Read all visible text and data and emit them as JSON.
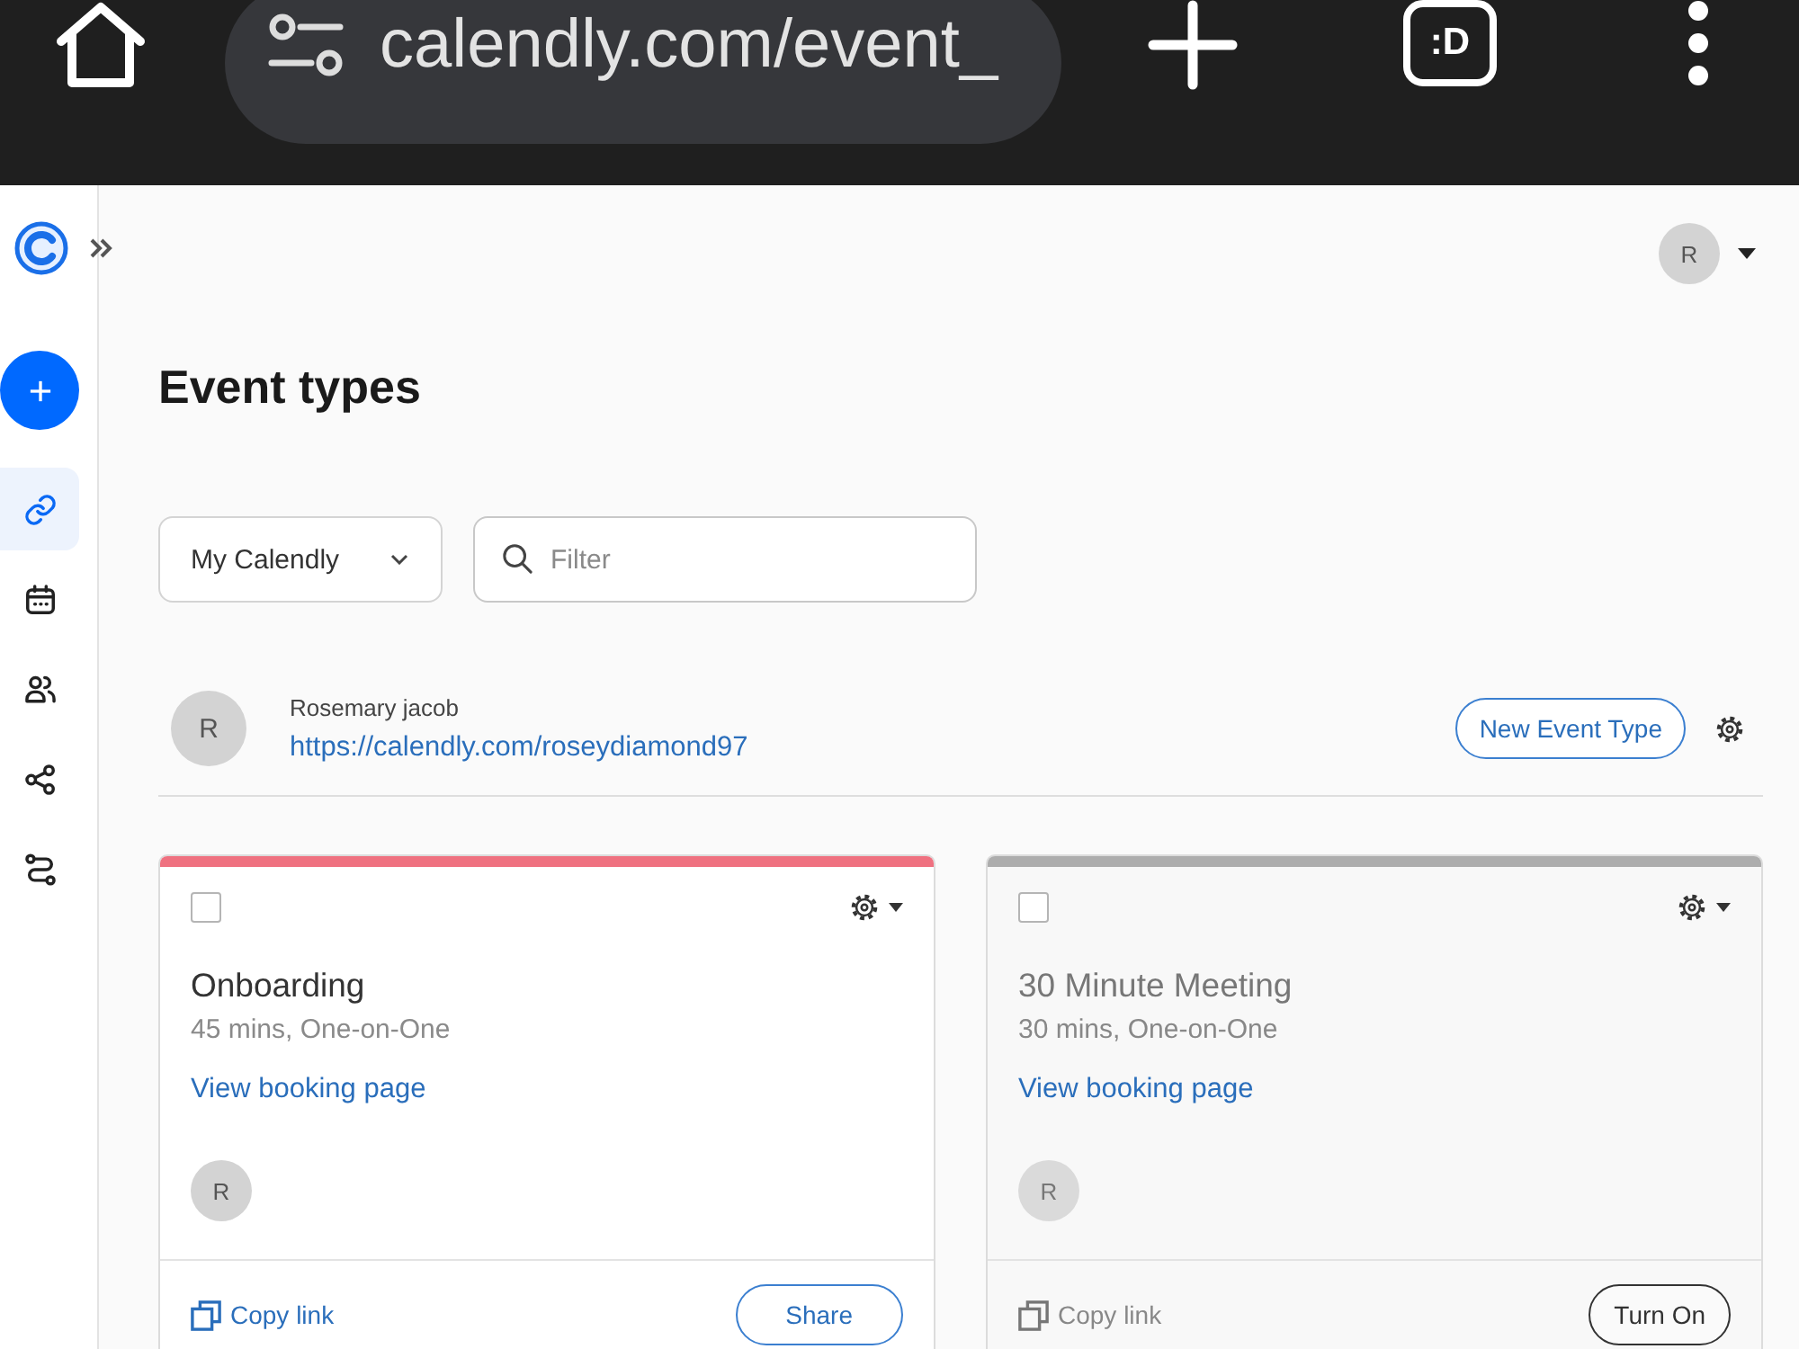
{
  "browser": {
    "url": "calendly.com/event_",
    "tab_switcher": ":D"
  },
  "sidebar": {
    "items": [
      {
        "selected": true
      },
      {
        "selected": false
      },
      {
        "selected": false
      },
      {
        "selected": false
      },
      {
        "selected": false
      }
    ]
  },
  "header": {
    "avatar": "R"
  },
  "title": "Event types",
  "filters": {
    "dropdown": "My Calendly",
    "search": {
      "placeholder": "Filter"
    }
  },
  "owner": {
    "avatar": "R",
    "name": "Rosemary jacob",
    "link": "https://calendly.com/roseydiamond97",
    "button": "New Event Type"
  },
  "event_types": [
    {
      "color": "#ef7180",
      "on": true,
      "checked": false,
      "title": "Onboarding",
      "details": "45 mins, One-on-One",
      "link": "View booking page",
      "host": "R",
      "copy": "Copy link",
      "action": "Share"
    },
    {
      "color": "#adadad",
      "on": false,
      "checked": false,
      "title": "30 Minute Meeting",
      "details": "30 mins, One-on-One",
      "link": "View booking page",
      "host": "R",
      "copy": "Copy link",
      "action": "Turn On"
    }
  ]
}
